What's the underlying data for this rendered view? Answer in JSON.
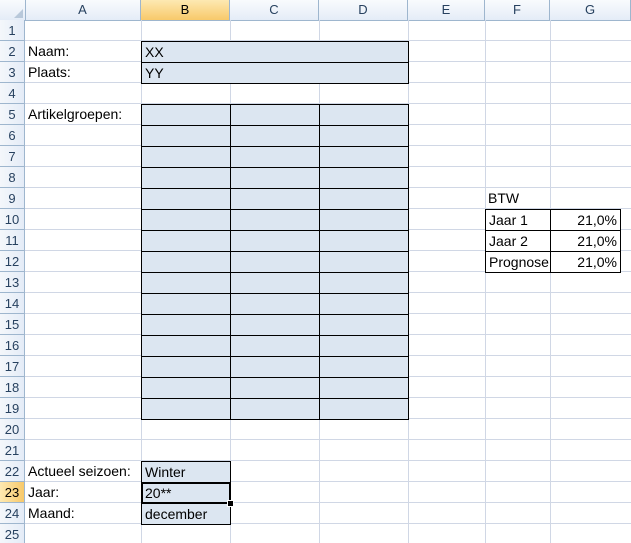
{
  "columns": [
    "A",
    "B",
    "C",
    "D",
    "E",
    "F",
    "G"
  ],
  "active_column": "B",
  "rows": [
    "1",
    "2",
    "3",
    "4",
    "5",
    "6",
    "7",
    "8",
    "9",
    "10",
    "11",
    "12",
    "13",
    "14",
    "15",
    "16",
    "17",
    "18",
    "19",
    "20",
    "21",
    "22",
    "23",
    "24",
    "25"
  ],
  "active_row": "23",
  "labels": {
    "naam": "Naam:",
    "plaats": "Plaats:",
    "artikelgroepen": "Artikelgroepen:",
    "actueel_seizoen": "Actueel seizoen:",
    "jaar": "Jaar:",
    "maand": "Maand:"
  },
  "values": {
    "naam": "XX",
    "plaats": "YY",
    "actueel_seizoen": "Winter",
    "jaar": "20**",
    "maand": "december"
  },
  "btw": {
    "title": "BTW",
    "rows": [
      {
        "label": "Jaar 1",
        "value": "21,0%"
      },
      {
        "label": "Jaar 2",
        "value": "21,0%"
      },
      {
        "label": "Prognose",
        "value": "21,0%"
      }
    ]
  },
  "colors": {
    "input_fill": "#dce6f1",
    "header_fill": "#e4ecf7",
    "active_header": "#f8c96a",
    "gridline": "#d0d7e5"
  }
}
